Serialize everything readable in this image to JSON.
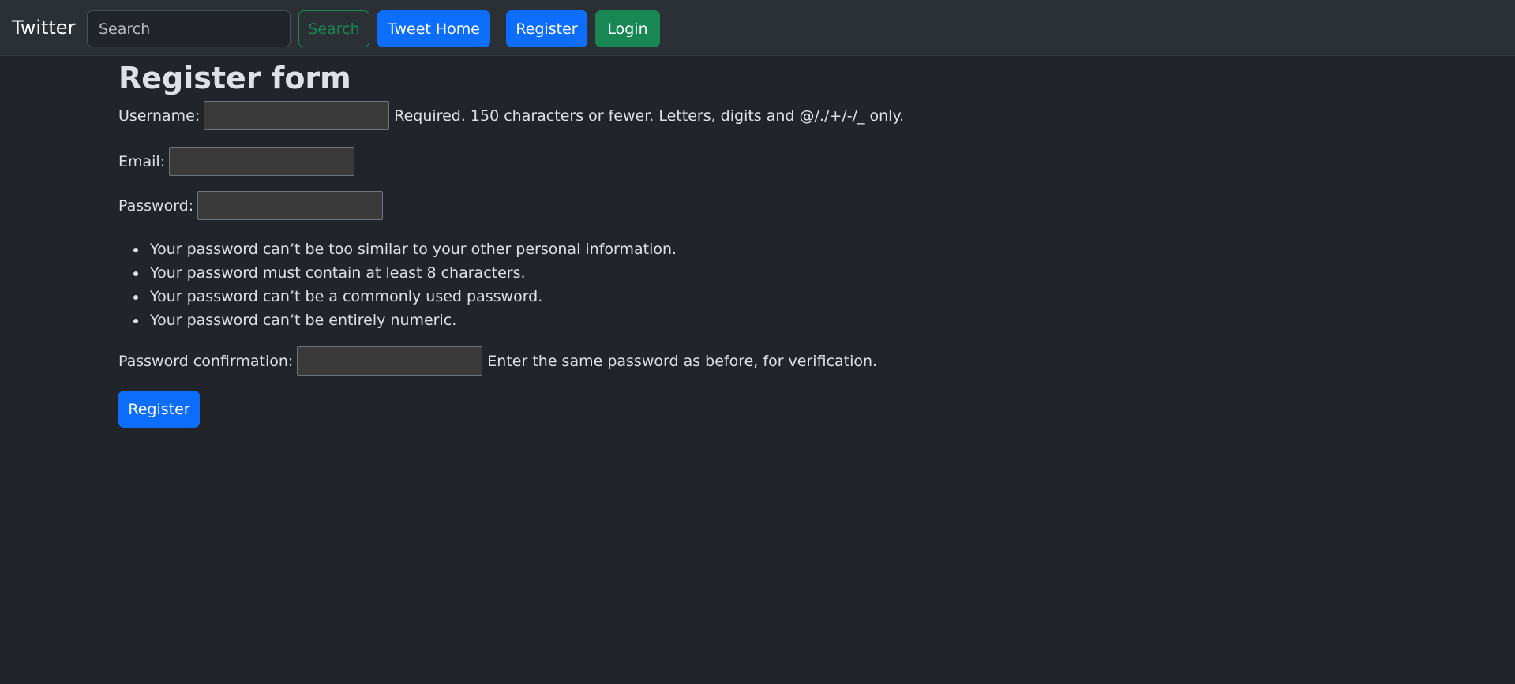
{
  "navbar": {
    "brand": "Twitter",
    "search_placeholder": "Search",
    "search_button": "Search",
    "home_button": "Tweet Home",
    "register_button": "Register",
    "login_button": "Login"
  },
  "form": {
    "title": "Register form",
    "username": {
      "label": "Username:",
      "value": "",
      "help": "Required. 150 characters or fewer. Letters, digits and @/./+/-/_ only."
    },
    "email": {
      "label": "Email:",
      "value": ""
    },
    "password": {
      "label": "Password:",
      "value": ""
    },
    "password_hints": [
      "Your password can’t be too similar to your other personal information.",
      "Your password must contain at least 8 characters.",
      "Your password can’t be a commonly used password.",
      "Your password can’t be entirely numeric."
    ],
    "password_confirmation": {
      "label": "Password confirmation:",
      "value": "",
      "help": "Enter the same password as before, for verification."
    },
    "submit_label": "Register"
  },
  "colors": {
    "background": "#212529",
    "navbar": "#2b3035",
    "primary": "#0d6efd",
    "success": "#198754",
    "text": "#dee2e6"
  }
}
